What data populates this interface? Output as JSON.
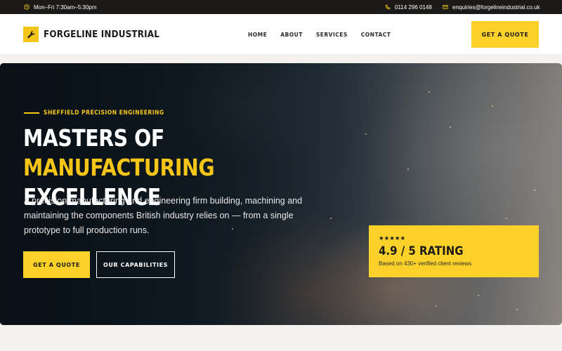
{
  "topbar": {
    "hours": "Mon–Fri 7:30am–5:30pm",
    "phone": "0114 296 0148",
    "email": "enquiries@forgelineindustrial.co.uk",
    "hours_icon": "clock-icon",
    "phone_icon": "phone-icon",
    "email_icon": "mail-icon",
    "icon_color": "#f5c518"
  },
  "header": {
    "logo_text": "FORGELINE INDUSTRIAL",
    "logo_icon": "wrench-icon",
    "nav": [
      "HOME",
      "ABOUT",
      "SERVICES",
      "CONTACT"
    ],
    "cta_label": "GET A QUOTE"
  },
  "hero": {
    "eyebrow": "SHEFFIELD PRECISION ENGINEERING",
    "headline_part1": "MASTERS OF ",
    "headline_accent": "MANUFACTURING",
    "headline_part2": "EXCELLENCE",
    "description": "A precision manufacturing and engineering firm building, machining and maintaining the components British industry relies on — from a single prototype to full production runs.",
    "primary_button": "GET A QUOTE",
    "secondary_button": "OUR CAPABILITIES"
  },
  "rating": {
    "stars": 5,
    "stars_text": "★★★★★",
    "title": "4.9 / 5 RATING",
    "subtitle": "Based on 430+ verified client reviews"
  },
  "colors": {
    "accent": "#f5c518",
    "button": "#fcd12a",
    "dark": "#1b1a19"
  }
}
